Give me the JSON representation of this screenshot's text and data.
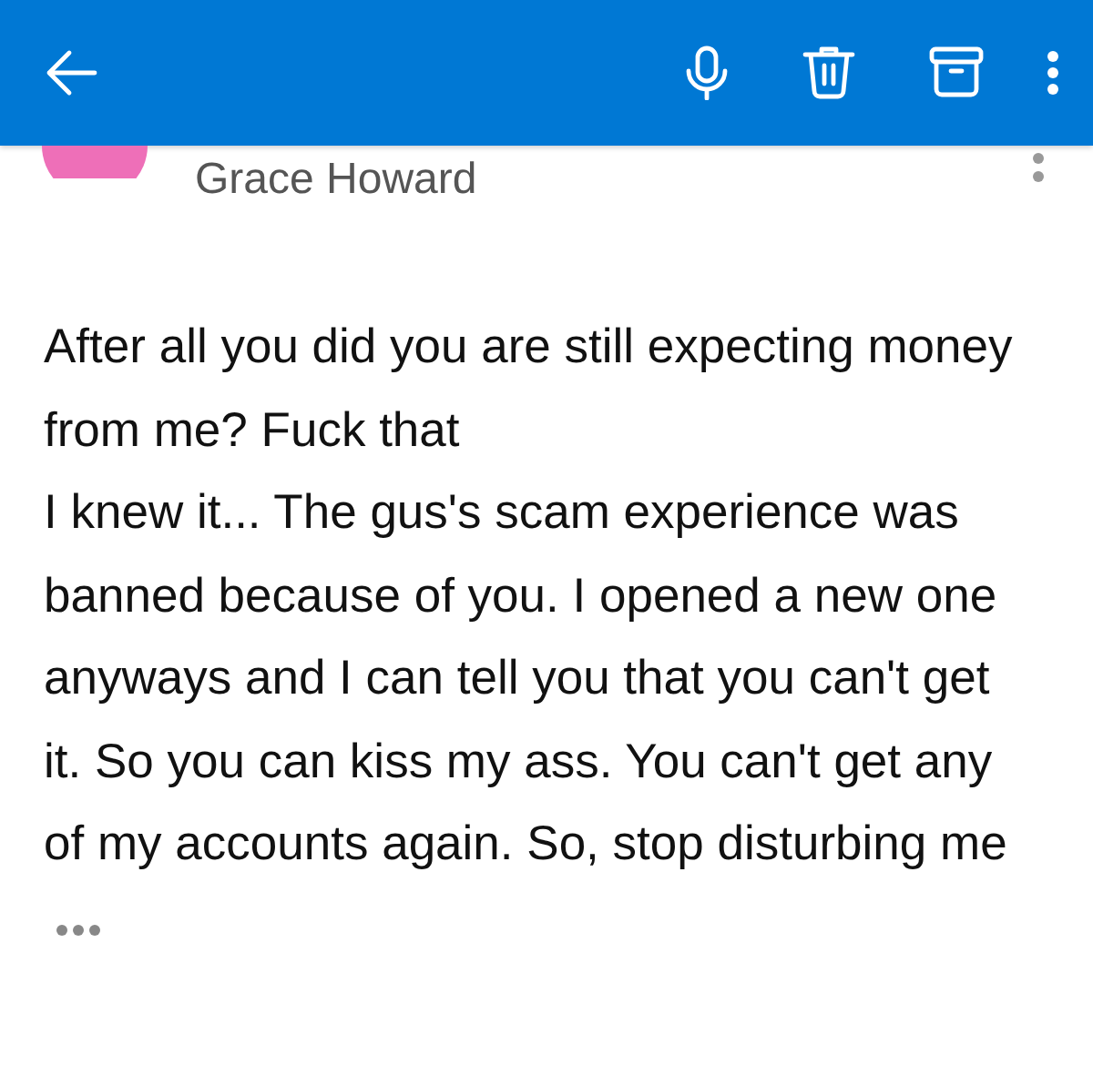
{
  "sender": {
    "name": "Grace Howard"
  },
  "body": {
    "paragraphs": [
      "After all you did you are still expecting money from me? Fuck that",
      "I knew it... The gus's scam experience was banned because of you. I opened a new one anyways and I can tell you that you can't get it. So you can kiss my ass. You can't get any of my accounts again. So, stop disturbing me"
    ]
  }
}
